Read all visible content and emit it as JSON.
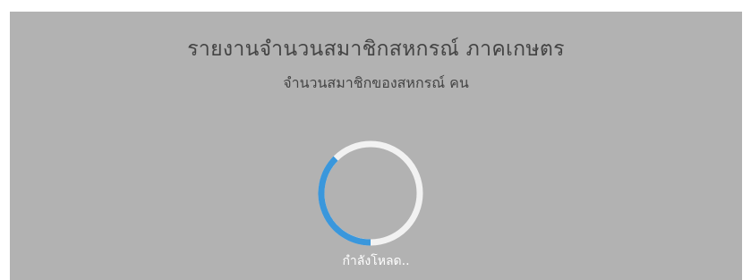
{
  "report": {
    "title": "รายงานจำนวนสมาชิกสหกรณ์ ภาคเกษตร",
    "subtitle": "จำนวนสมาชิกของสหกรณ์ คน"
  },
  "loader": {
    "text": "กำลังโหลด..",
    "track_color": "#f2f2f2",
    "accent_color": "#3a97dc"
  },
  "colors": {
    "overlay": "#b2b2b2",
    "text": "#444444"
  }
}
